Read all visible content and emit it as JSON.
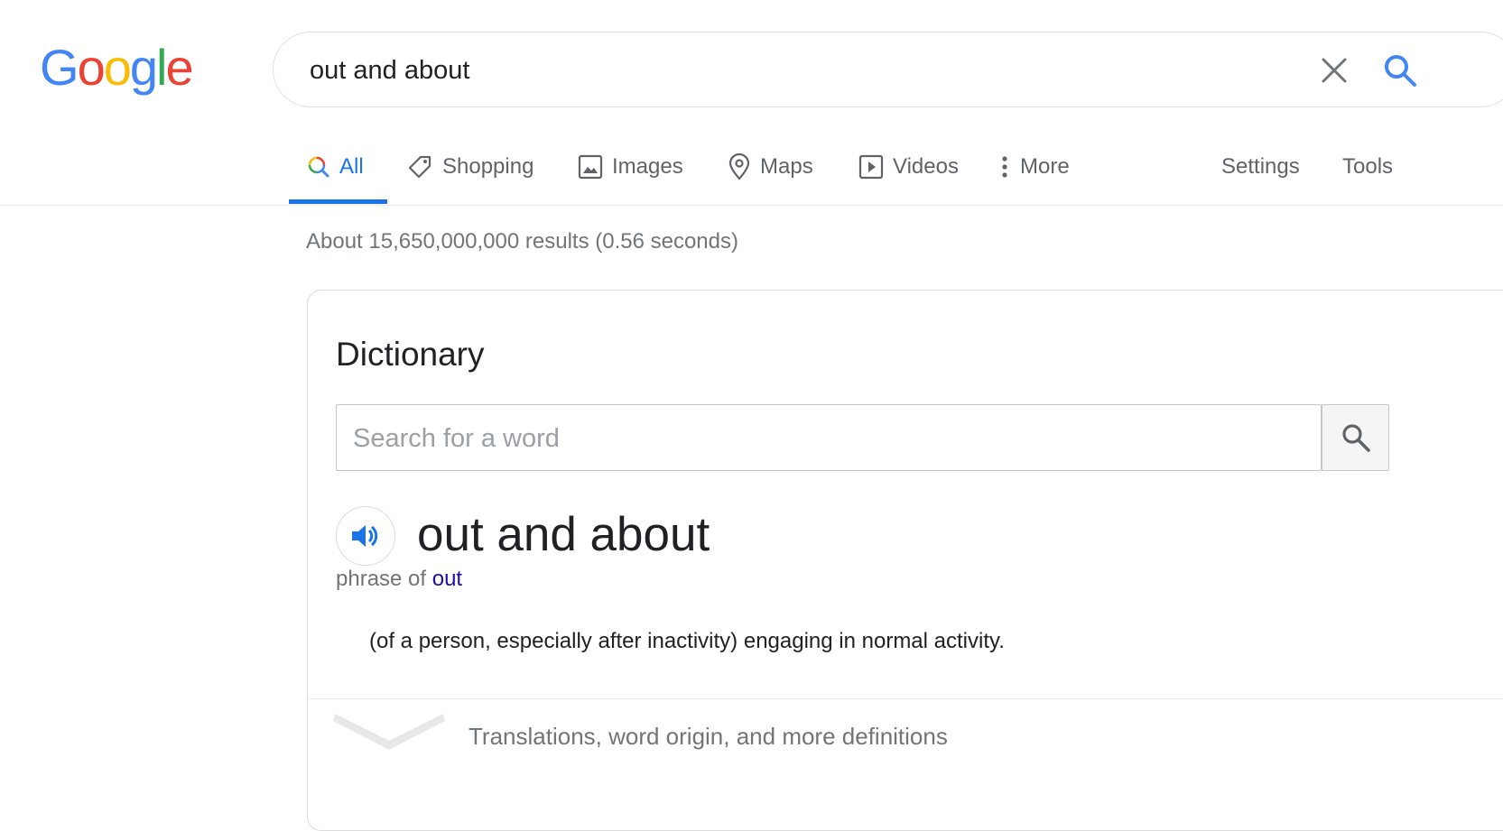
{
  "logo": {
    "letters": [
      "G",
      "o",
      "o",
      "g",
      "l",
      "e"
    ],
    "colors": [
      "#4285F4",
      "#EA4335",
      "#FBBC05",
      "#4285F4",
      "#34A853",
      "#EA4335"
    ]
  },
  "search": {
    "query": "out and about"
  },
  "tabs": {
    "items": [
      {
        "label": "All",
        "icon": "search-icon"
      },
      {
        "label": "Shopping",
        "icon": "tag-icon"
      },
      {
        "label": "Images",
        "icon": "image-icon"
      },
      {
        "label": "Maps",
        "icon": "map-pin-icon"
      },
      {
        "label": "Videos",
        "icon": "play-icon"
      },
      {
        "label": "More",
        "icon": "more-vert-icon"
      }
    ],
    "settings": "Settings",
    "tools": "Tools",
    "active_color": "#1a73e8"
  },
  "stats": "About 15,650,000,000 results (0.56 seconds)",
  "dictionary": {
    "title": "Dictionary",
    "search_placeholder": "Search for a word",
    "word": "out and about",
    "phrase_prefix": "phrase of ",
    "phrase_link": "out",
    "definition": "(of a person, especially after inactivity) engaging in normal activity.",
    "more_label": "Translations, word origin, and more definitions"
  }
}
